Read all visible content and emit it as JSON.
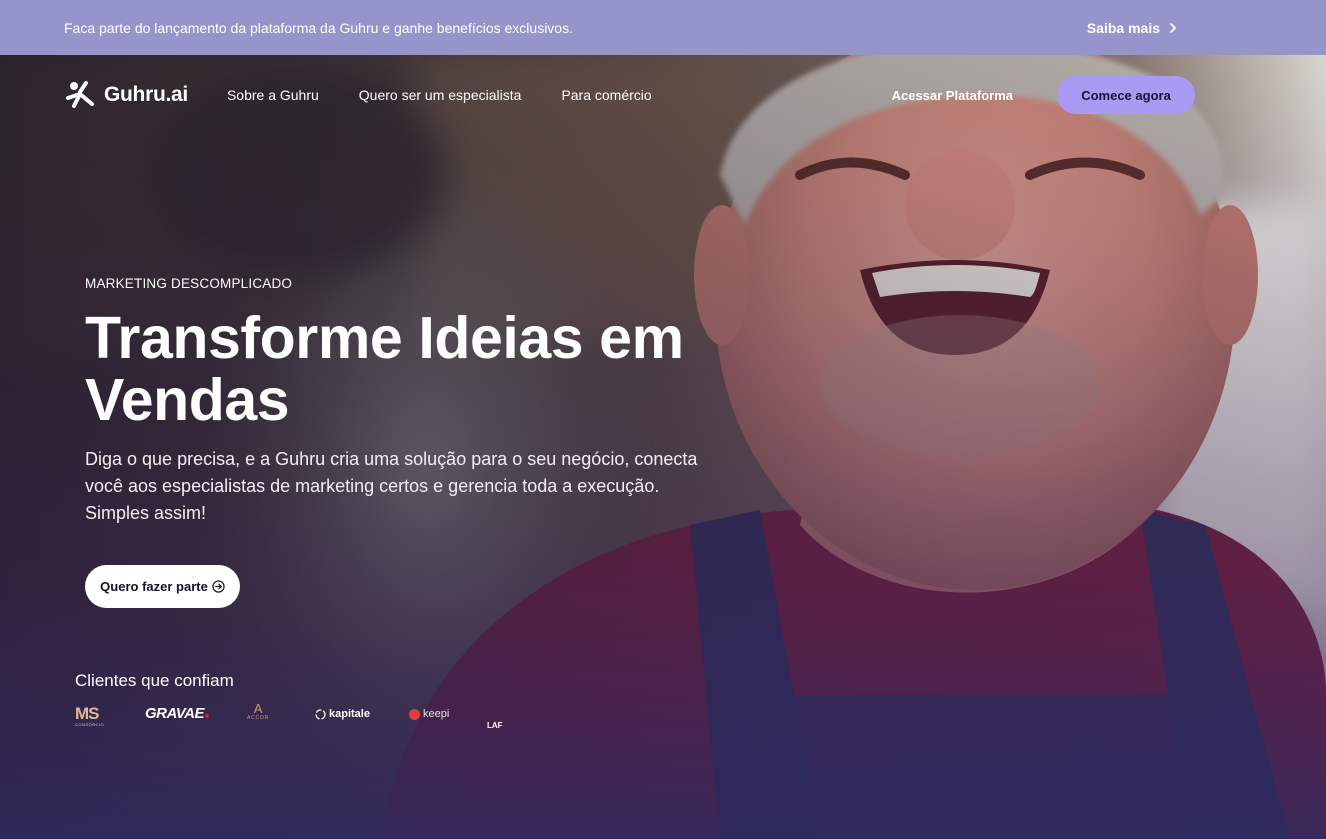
{
  "announcement": {
    "text": "Faca parte do lançamento da plataforma da Guhru e ganhe benefícios exclusivos.",
    "link_label": "Saiba mais",
    "link_icon": "chevron-right-icon"
  },
  "nav": {
    "logo_text": "Guhru.ai",
    "logo_icon": "guhru-logo-icon",
    "links": [
      "Sobre a Guhru",
      "Quero ser um especialista",
      "Para comércio"
    ],
    "access_label": "Acessar Plataforma",
    "cta_label": "Comece agora"
  },
  "hero": {
    "eyebrow": "MARKETING DESCOMPLICADO",
    "headline": "Transforme Ideias em Vendas",
    "subheadline": "Diga o que precisa, e a Guhru cria uma solução para o seu negócio, conecta você aos especialistas de marketing certos e gerencia toda a execução. Simples assim!",
    "cta_label": "Quero fazer parte",
    "cta_icon": "arrow-right-circle-icon"
  },
  "clients": {
    "title": "Clientes que confiam",
    "logos": [
      {
        "name": "MS",
        "sub": "CONSÓRCIO"
      },
      {
        "name": "GRAVAE"
      },
      {
        "name": "A",
        "sub": "ACCOR"
      },
      {
        "name": "kapitale"
      },
      {
        "name": "keepi"
      },
      {
        "name": "LAF"
      }
    ]
  },
  "colors": {
    "announcement_bg": "#9595cc",
    "cta_primary": "#a99af4",
    "cta_secondary_bg": "#ffffff"
  }
}
